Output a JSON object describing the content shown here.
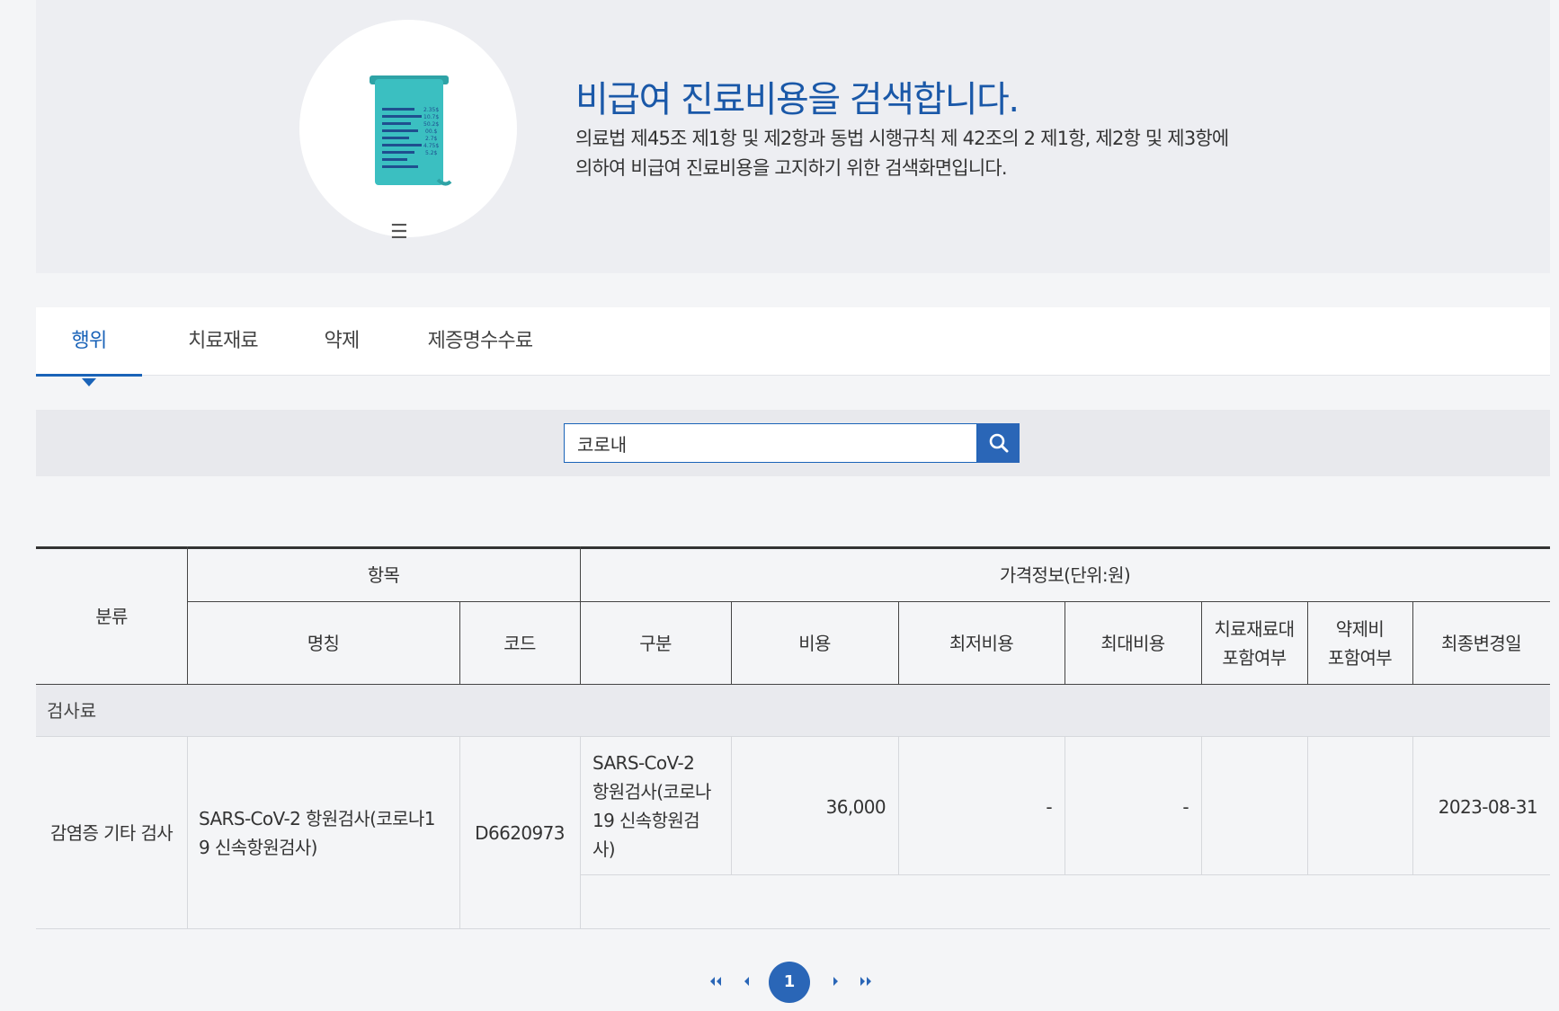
{
  "hero": {
    "title": "비급여 진료비용을 검색합니다.",
    "desc_line1": "의료법 제45조 제1항 및 제2항과 동법 시행규칙 제 42조의 2 제1항, 제2항 및 제3항에",
    "desc_line2": "의하여 비급여 진료비용을 고지하기 위한 검색화면입니다.",
    "receipt_values": [
      "2.35$",
      "10.7$",
      "50.2$",
      "00.$",
      "2.7$",
      "4.75$",
      "5.2$"
    ],
    "menu_icon": "hamburger-icon"
  },
  "tabs": [
    {
      "label": "행위",
      "active": true
    },
    {
      "label": "치료재료",
      "active": false
    },
    {
      "label": "약제",
      "active": false
    },
    {
      "label": "제증명수수료",
      "active": false
    }
  ],
  "search": {
    "value": "코로내",
    "button_icon": "search-icon"
  },
  "table": {
    "headers": {
      "category": "분류",
      "item_group": "항목",
      "price_group": "가격정보(단위:원)",
      "name": "명칭",
      "code": "코드",
      "division": "구분",
      "cost": "비용",
      "min_cost": "최저비용",
      "max_cost": "최대비용",
      "material_line1": "치료재료대",
      "material_line2": "포함여부",
      "drug_line1": "약제비",
      "drug_line2": "포함여부",
      "last_changed": "최종변경일"
    },
    "group_label": "검사료",
    "rows": [
      {
        "category": "감염증 기타 검사",
        "name_line1": "SARS-CoV-2 항원검사(코로나1",
        "name_line2": "9 신속항원검사)",
        "code": "D6620973",
        "division_lines": [
          "SARS-CoV-2",
          "항원검사(코로나",
          "19 신속항원검",
          "사)"
        ],
        "cost": "36,000",
        "min_cost": "-",
        "max_cost": "-",
        "material_included": "",
        "drug_included": "",
        "last_changed": "2023-08-31"
      }
    ]
  },
  "pagination": {
    "first": "first-page-icon",
    "prev": "prev-page-icon",
    "current": "1",
    "next": "next-page-icon",
    "last": "last-page-icon"
  },
  "colors": {
    "accent": "#1a63b8",
    "title_blue": "#1a58a8",
    "receipt_teal": "#3bbfc1"
  }
}
